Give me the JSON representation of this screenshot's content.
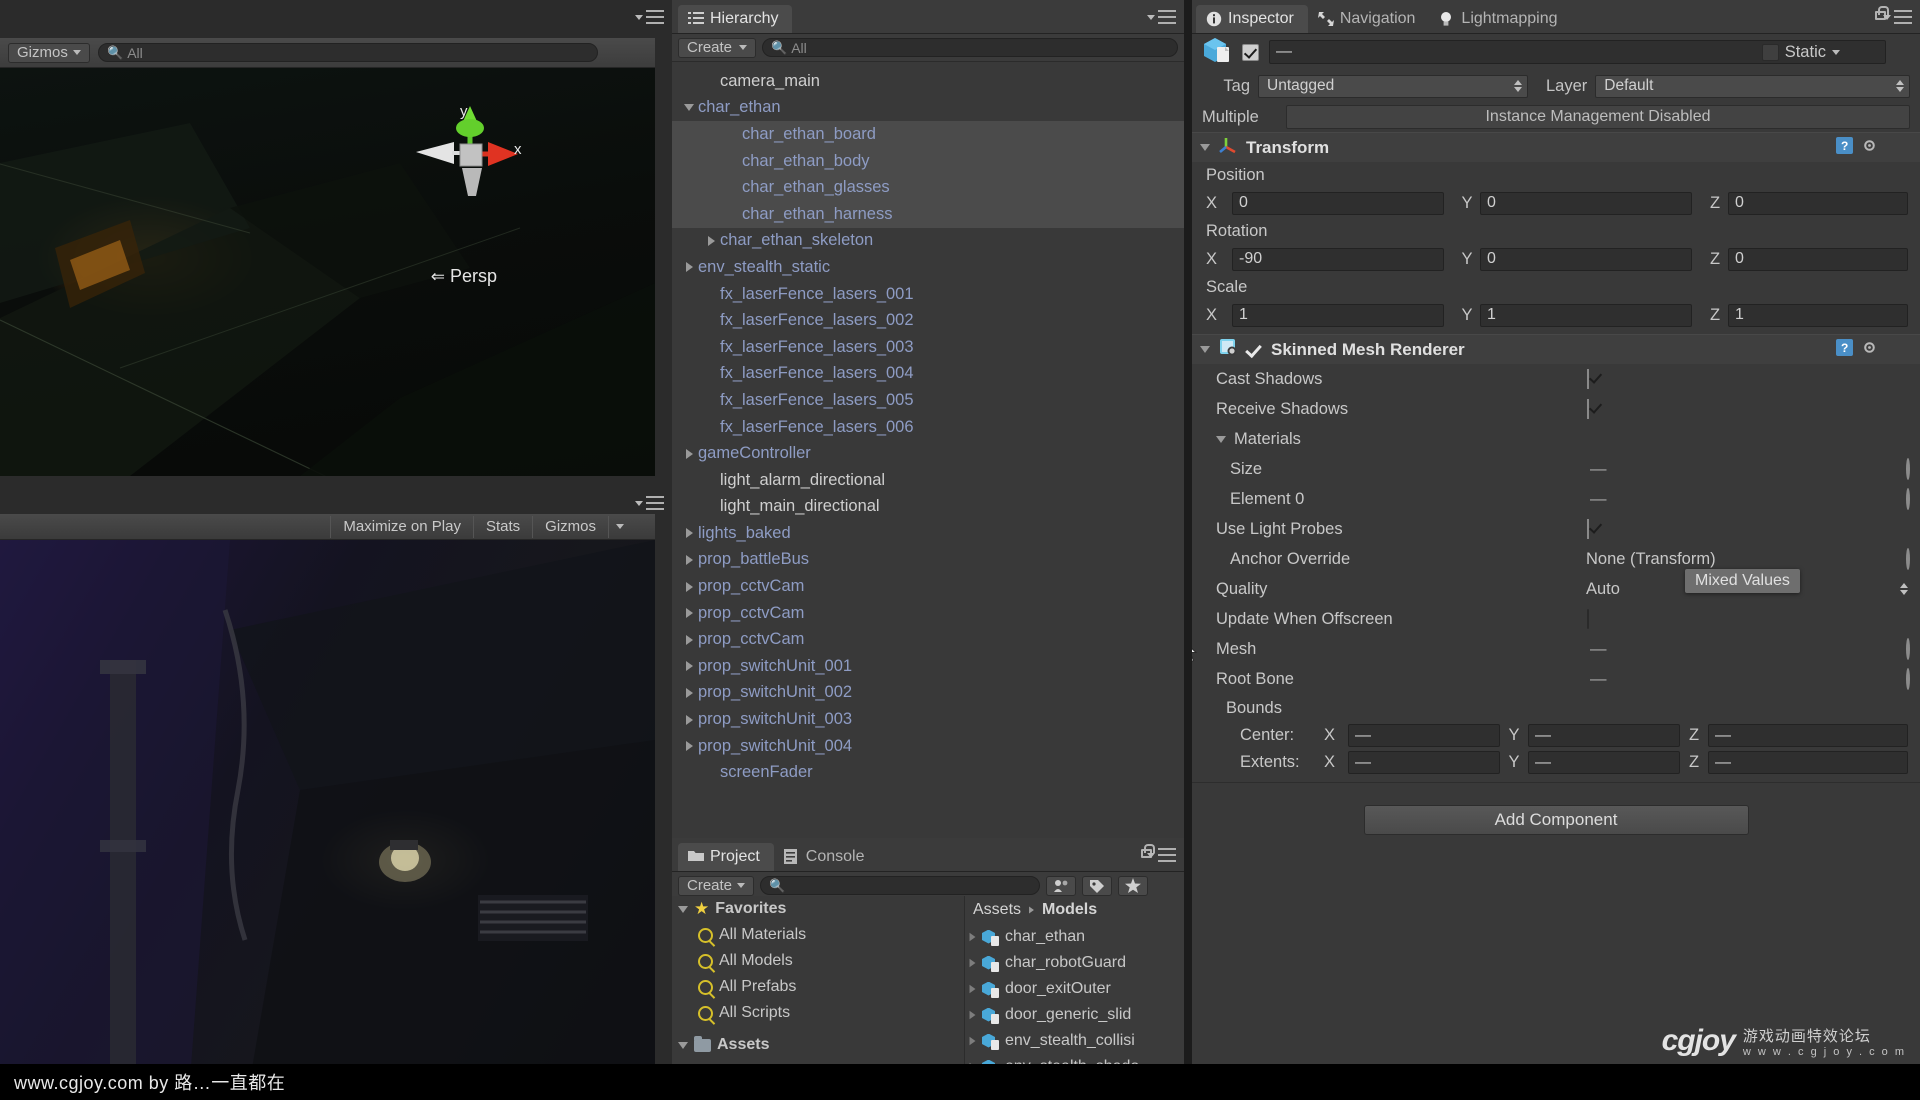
{
  "scene_view": {
    "tab_menu_icon": "panel-menu-icon",
    "toolbar": {
      "gizmos_label": "Gizmos",
      "search_placeholder": "All",
      "search_icon": "search-icon"
    },
    "viewport": {
      "axis_labels": [
        "y",
        "x"
      ],
      "projection_label": "Persp"
    }
  },
  "game_view": {
    "toolbar": {
      "maximize_label": "Maximize on Play",
      "stats_label": "Stats",
      "gizmos_label": "Gizmos"
    }
  },
  "hierarchy": {
    "tab_label": "Hierarchy",
    "tab_icon": "list-icon",
    "create_label": "Create",
    "search_placeholder": "All",
    "items": [
      {
        "label": "camera_main",
        "indent": 1,
        "arrow": "none",
        "color": "white",
        "selected": false
      },
      {
        "label": "char_ethan",
        "indent": 0,
        "arrow": "open",
        "color": "blue",
        "selected": false
      },
      {
        "label": "char_ethan_board",
        "indent": 2,
        "arrow": "none",
        "color": "blue",
        "selected": true
      },
      {
        "label": "char_ethan_body",
        "indent": 2,
        "arrow": "none",
        "color": "blue",
        "selected": true
      },
      {
        "label": "char_ethan_glasses",
        "indent": 2,
        "arrow": "none",
        "color": "blue",
        "selected": true
      },
      {
        "label": "char_ethan_harness",
        "indent": 2,
        "arrow": "none",
        "color": "blue",
        "selected": true
      },
      {
        "label": "char_ethan_skeleton",
        "indent": 1,
        "arrow": "closed",
        "color": "blue",
        "selected": false
      },
      {
        "label": "env_stealth_static",
        "indent": 0,
        "arrow": "closed",
        "color": "blue",
        "selected": false
      },
      {
        "label": "fx_laserFence_lasers_001",
        "indent": 1,
        "arrow": "none",
        "color": "blue",
        "selected": false
      },
      {
        "label": "fx_laserFence_lasers_002",
        "indent": 1,
        "arrow": "none",
        "color": "blue",
        "selected": false
      },
      {
        "label": "fx_laserFence_lasers_003",
        "indent": 1,
        "arrow": "none",
        "color": "blue",
        "selected": false
      },
      {
        "label": "fx_laserFence_lasers_004",
        "indent": 1,
        "arrow": "none",
        "color": "blue",
        "selected": false
      },
      {
        "label": "fx_laserFence_lasers_005",
        "indent": 1,
        "arrow": "none",
        "color": "blue",
        "selected": false
      },
      {
        "label": "fx_laserFence_lasers_006",
        "indent": 1,
        "arrow": "none",
        "color": "blue",
        "selected": false
      },
      {
        "label": "gameController",
        "indent": 0,
        "arrow": "closed",
        "color": "blue",
        "selected": false
      },
      {
        "label": "light_alarm_directional",
        "indent": 1,
        "arrow": "none",
        "color": "white",
        "selected": false
      },
      {
        "label": "light_main_directional",
        "indent": 1,
        "arrow": "none",
        "color": "white",
        "selected": false
      },
      {
        "label": "lights_baked",
        "indent": 0,
        "arrow": "closed",
        "color": "blue",
        "selected": false
      },
      {
        "label": "prop_battleBus",
        "indent": 0,
        "arrow": "closed",
        "color": "blue",
        "selected": false
      },
      {
        "label": "prop_cctvCam",
        "indent": 0,
        "arrow": "closed",
        "color": "blue",
        "selected": false
      },
      {
        "label": "prop_cctvCam",
        "indent": 0,
        "arrow": "closed",
        "color": "blue",
        "selected": false
      },
      {
        "label": "prop_cctvCam",
        "indent": 0,
        "arrow": "closed",
        "color": "blue",
        "selected": false
      },
      {
        "label": "prop_switchUnit_001",
        "indent": 0,
        "arrow": "closed",
        "color": "blue",
        "selected": false
      },
      {
        "label": "prop_switchUnit_002",
        "indent": 0,
        "arrow": "closed",
        "color": "blue",
        "selected": false
      },
      {
        "label": "prop_switchUnit_003",
        "indent": 0,
        "arrow": "closed",
        "color": "blue",
        "selected": false
      },
      {
        "label": "prop_switchUnit_004",
        "indent": 0,
        "arrow": "closed",
        "color": "blue",
        "selected": false
      },
      {
        "label": "screenFader",
        "indent": 1,
        "arrow": "none",
        "color": "blue",
        "selected": false
      }
    ]
  },
  "project": {
    "tabs": [
      {
        "label": "Project",
        "icon": "folder-icon",
        "active": true
      },
      {
        "label": "Console",
        "icon": "console-icon",
        "active": false
      }
    ],
    "create_label": "Create",
    "search_placeholder": "",
    "favorites_label": "Favorites",
    "favorites": [
      "All Materials",
      "All Models",
      "All Prefabs",
      "All Scripts"
    ],
    "assets_label": "Assets",
    "breadcrumb": [
      "Assets",
      "Models"
    ],
    "files": [
      "char_ethan",
      "char_robotGuard",
      "door_exitOuter",
      "door_generic_slid",
      "env_stealth_collisi",
      "env_stealth_shado"
    ]
  },
  "inspector": {
    "tabs": [
      {
        "label": "Inspector",
        "icon": "info-icon",
        "active": true
      },
      {
        "label": "Navigation",
        "icon": "navmesh-icon",
        "active": false
      },
      {
        "label": "Lightmapping",
        "icon": "lightbulb-icon",
        "active": false
      }
    ],
    "object_header": {
      "icon": "prefab-cube-icon",
      "enabled_checkbox": true,
      "name_value": "—",
      "static_label": "Static",
      "static_checked": false
    },
    "tag_label": "Tag",
    "tag_value": "Untagged",
    "layer_label": "Layer",
    "layer_value": "Default",
    "multiple_label": "Multiple",
    "instance_management_label": "Instance Management Disabled",
    "transform": {
      "title": "Transform",
      "icon": "transform-axis-icon",
      "position_label": "Position",
      "position": {
        "x": "0",
        "y": "0",
        "z": "0"
      },
      "rotation_label": "Rotation",
      "rotation": {
        "x": "-90",
        "y": "0",
        "z": "0"
      },
      "scale_label": "Scale",
      "scale": {
        "x": "1",
        "y": "1",
        "z": "1"
      }
    },
    "skinned_mesh_renderer": {
      "title": "Skinned Mesh Renderer",
      "icon": "mesh-renderer-icon",
      "enabled": true,
      "rows": [
        {
          "label": "Cast Shadows",
          "indent": 1,
          "type": "check",
          "value": "on"
        },
        {
          "label": "Receive Shadows",
          "indent": 1,
          "type": "check",
          "value": "on"
        },
        {
          "label": "Materials",
          "indent": 1,
          "type": "fold",
          "value": ""
        },
        {
          "label": "Size",
          "indent": 2,
          "type": "dash",
          "value": "—"
        },
        {
          "label": "Element 0",
          "indent": 2,
          "type": "dash",
          "value": "—"
        },
        {
          "label": "Use Light Probes",
          "indent": 1,
          "type": "check",
          "value": "on"
        },
        {
          "label": "Anchor Override",
          "indent": 2,
          "type": "objref",
          "value": "None (Transform)"
        },
        {
          "label": "Quality",
          "indent": 1,
          "type": "popup",
          "value": "Auto"
        },
        {
          "label": "Update When Offscreen",
          "indent": 1,
          "type": "check",
          "value": "off"
        },
        {
          "label": "Mesh",
          "indent": 1,
          "type": "dash",
          "value": "—"
        },
        {
          "label": "Root Bone",
          "indent": 1,
          "type": "dash",
          "value": "—"
        }
      ],
      "bounds_label": "Bounds",
      "bounds": {
        "center_label": "Center:",
        "center": {
          "x": "—",
          "y": "—",
          "z": "—"
        },
        "extents_label": "Extents:",
        "extents": {
          "x": "—",
          "y": "—",
          "z": "—"
        }
      }
    },
    "tooltip": {
      "text": "Mixed Values",
      "visible": true
    },
    "add_component_label": "Add Component"
  },
  "watermark": {
    "bottom_text": "www.cgjoy.com by 路…一直都在",
    "logo_text": "cgjoy",
    "logo_cn": "游戏动画特效论坛",
    "logo_url": "w w w . c g j o y . c o m"
  },
  "colors": {
    "panel_bg": "#393939",
    "tab_active": "#4b4b4b",
    "hierarchy_blue": "#8e9cc4",
    "accent_yellow": "#d6c02a"
  }
}
